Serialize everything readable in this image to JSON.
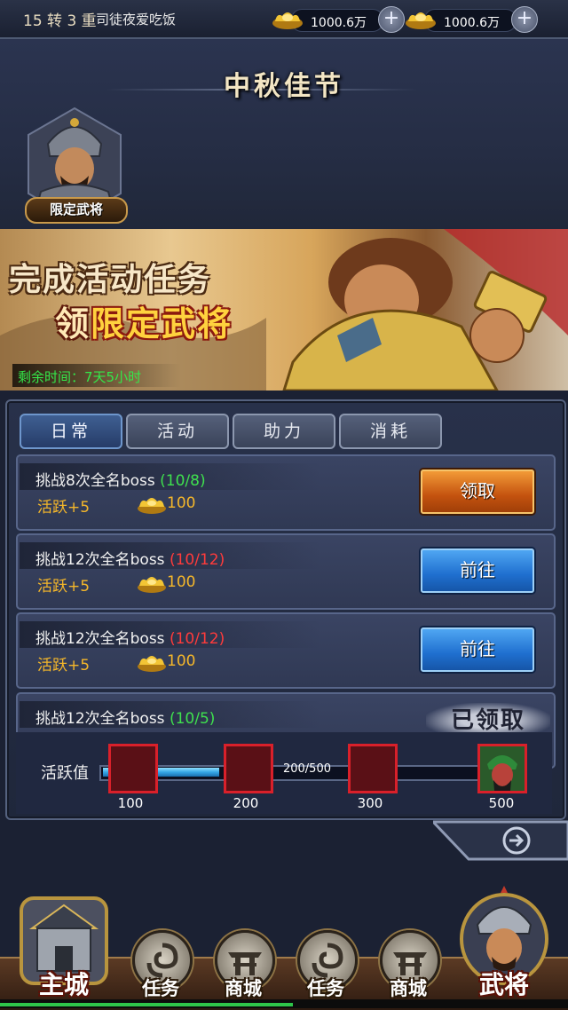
{
  "topbar": {
    "level": "15 转 3 重",
    "player_name": "司徒夜爱吃饭",
    "currencies": [
      {
        "icon": "gold-ingot-icon",
        "value": "1000.6万"
      },
      {
        "icon": "gold-ingot-icon",
        "value": "1000.6万"
      }
    ]
  },
  "header": {
    "title": "中秋佳节",
    "limited_general_label": "限定武将"
  },
  "banner": {
    "line1": "完成活动任务",
    "line2_prefix": "领",
    "line2_highlight": "限定武将",
    "remaining_time": "剩余时间：7天5小时"
  },
  "tabs": [
    {
      "label": "日常",
      "active": true
    },
    {
      "label": "活动",
      "active": false
    },
    {
      "label": "助力",
      "active": false
    },
    {
      "label": "消耗",
      "active": false
    }
  ],
  "tasks": [
    {
      "name": "挑战8次全名boss",
      "progress": "(10/8)",
      "activity": "活跃+5",
      "gold": "100",
      "button": "领取"
    },
    {
      "name": "挑战12次全名boss",
      "progress": "(10/12)",
      "activity": "活跃+5",
      "gold": "100",
      "button": "前往"
    },
    {
      "name": "挑战12次全名boss",
      "progress": "(10/12)",
      "activity": "活跃+5",
      "gold": "100",
      "button": "前往"
    },
    {
      "name": "挑战12次全名boss",
      "progress": "(10/5)",
      "status": "已领取"
    }
  ],
  "activity_bar": {
    "label": "活跃值",
    "progress_text": "200/500",
    "progress_fraction": 0.31,
    "milestones": [
      "100",
      "200",
      "300",
      "500"
    ]
  },
  "nav": {
    "main_city": "主城",
    "items": [
      "任务",
      "商城",
      "任务",
      "商城"
    ],
    "generals": "武将"
  },
  "colors": {
    "progress_green": "#3fe04e",
    "progress_red": "#ff3b3b",
    "activity_gold": "#f5b72a",
    "button_orange": "#e07a22",
    "button_blue": "#2a84dc"
  }
}
